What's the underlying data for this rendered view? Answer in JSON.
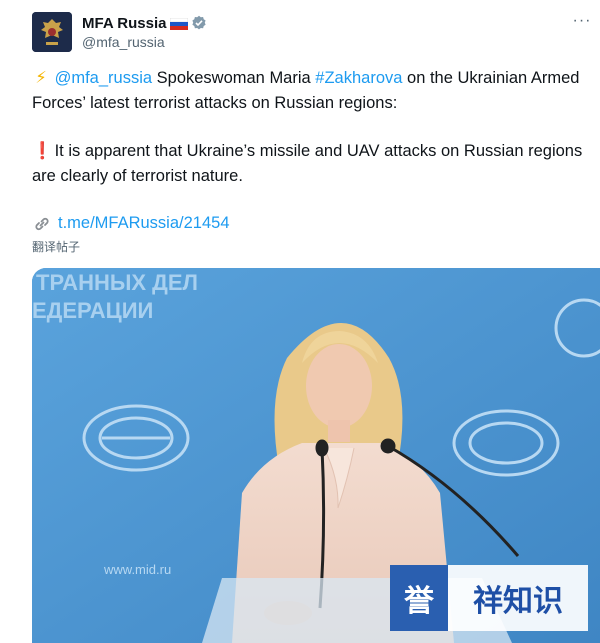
{
  "tweet": {
    "display_name": "MFA Russia",
    "handle": "@mfa_russia",
    "more_label": "···",
    "p1": {
      "emoji": "⚡",
      "mention": "@mfa_russia",
      "text_a": " Spokeswoman Maria ",
      "hashtag": "#Zakharova",
      "text_b": " on the Ukrainian Armed Forces’ latest terrorist attacks on Russian regions:"
    },
    "p2": {
      "emoji": "❗",
      "text": " It is apparent that Ukraine’s missile and UAV attacks on Russian regions are clearly of terrorist nature."
    },
    "link": "t.me/MFARussia/21454",
    "translate": "翻译帖子",
    "media": {
      "backdrop_lines": [
        "ТРАННЫХ ДЕЛ",
        "ЕДЕРАЦИИ"
      ],
      "site_text": "www.mid.ru"
    }
  },
  "watermark": {
    "badge": "誉",
    "text": "祥知识"
  },
  "colors": {
    "link": "#1d9bf0",
    "backdrop": "#4a93cf",
    "watermark_blue": "#2a5fb0"
  }
}
